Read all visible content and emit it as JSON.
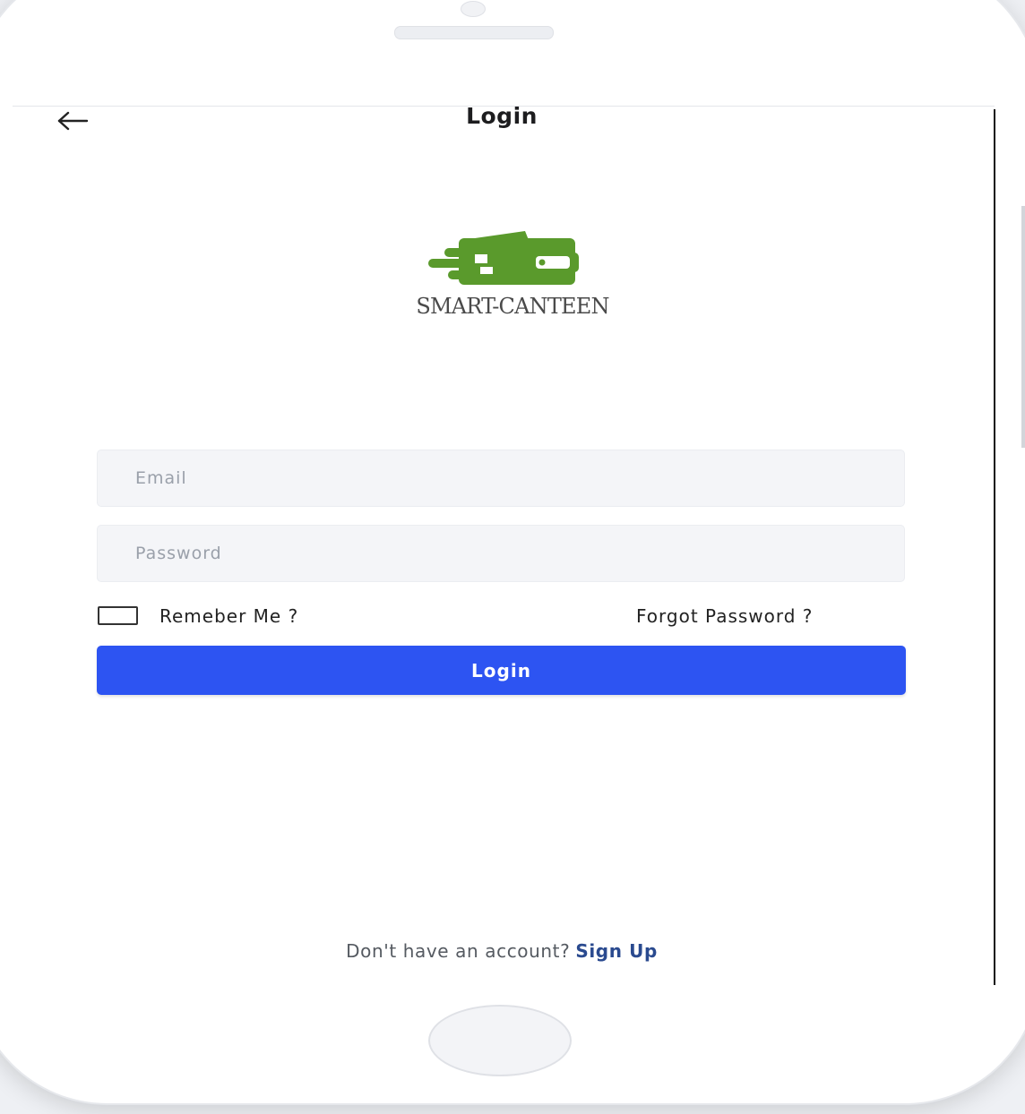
{
  "header": {
    "title": "Login",
    "back_icon": "arrow-left-icon"
  },
  "brand": {
    "name": "SMART-CANTEEN",
    "logo_icon": "wallet-logo-icon",
    "logo_color": "#5a9a2c"
  },
  "form": {
    "email_placeholder": "Email",
    "email_value": "",
    "password_placeholder": "Password",
    "password_value": "",
    "remember_label": "Remeber Me ?",
    "remember_checked": false,
    "forgot_label": "Forgot Password ?",
    "login_label": "Login",
    "login_color": "#2d54f2"
  },
  "footer": {
    "prompt": "Don't have an account?",
    "signup_label": "Sign Up"
  }
}
